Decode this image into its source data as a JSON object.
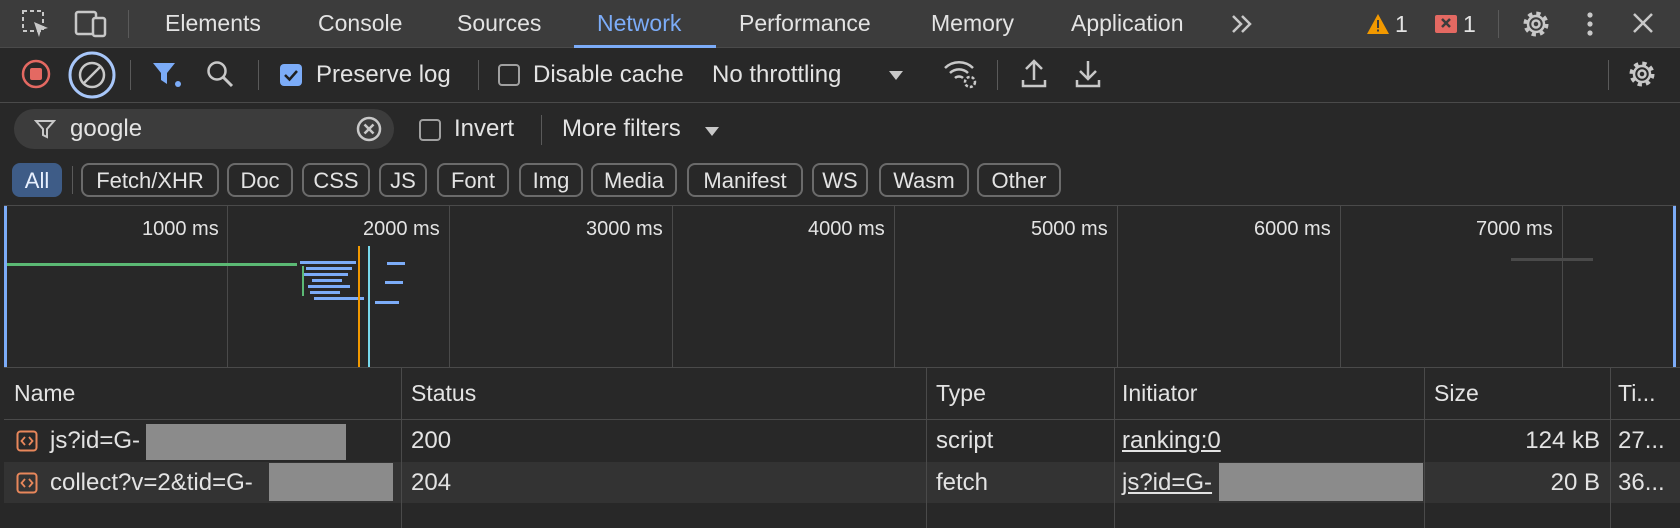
{
  "tabs": [
    "Elements",
    "Console",
    "Sources",
    "Network",
    "Performance",
    "Memory",
    "Application"
  ],
  "active_tab": "Network",
  "more_tabs_icon": "chevron-double-right",
  "warnings_count": "1",
  "errors_count": "1",
  "toolbar": {
    "preserve_log_label": "Preserve log",
    "preserve_log_checked": true,
    "disable_cache_label": "Disable cache",
    "disable_cache_checked": false,
    "throttling_value": "No throttling"
  },
  "filter": {
    "value": "google",
    "invert_label": "Invert",
    "more_filters_label": "More filters"
  },
  "type_filters": [
    "All",
    "Fetch/XHR",
    "Doc",
    "CSS",
    "JS",
    "Font",
    "Img",
    "Media",
    "Manifest",
    "WS",
    "Wasm",
    "Other"
  ],
  "active_type_filter": "All",
  "timeline_ticks": [
    "1000 ms",
    "2000 ms",
    "3000 ms",
    "4000 ms",
    "5000 ms",
    "6000 ms",
    "7000 ms"
  ],
  "columns": [
    "Name",
    "Status",
    "Type",
    "Initiator",
    "Size",
    "Ti..."
  ],
  "rows": [
    {
      "name": "js?id=G-",
      "status": "200",
      "type": "script",
      "initiator": "ranking:0",
      "size": "124 kB",
      "time": "27..."
    },
    {
      "name": "collect?v=2&tid=G-",
      "status": "204",
      "type": "fetch",
      "initiator": "js?id=G-",
      "size": "20 B",
      "time": "36..."
    }
  ],
  "colors": {
    "accent": "#7cacf8",
    "record": "#e46962",
    "warning": "#f29900",
    "error": "#e46962"
  }
}
